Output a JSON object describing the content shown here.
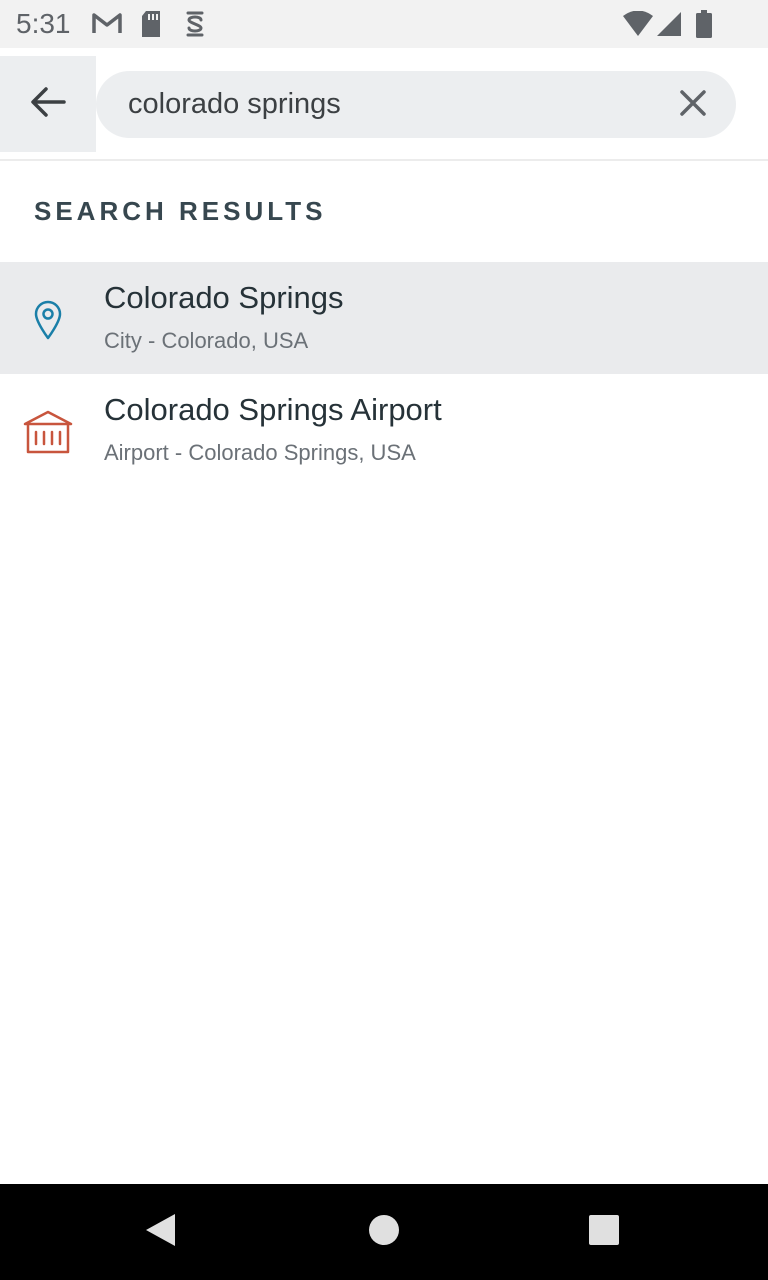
{
  "status_bar": {
    "time": "5:31",
    "left_icons": [
      "gmail-icon",
      "sd-card-icon",
      "sync-icon"
    ],
    "right_icons": [
      "wifi-icon",
      "cell-signal-icon",
      "battery-icon"
    ]
  },
  "search": {
    "query": "colorado springs",
    "back_icon": "arrow-left-icon",
    "clear_icon": "close-icon"
  },
  "section": {
    "title": "SEARCH RESULTS"
  },
  "results": [
    {
      "title": "Colorado Springs",
      "subtitle": "City - Colorado, USA",
      "icon": "location-pin-icon",
      "icon_color": "#1a7fa8",
      "highlighted": true
    },
    {
      "title": "Colorado Springs Airport",
      "subtitle": "Airport - Colorado Springs, USA",
      "icon": "airport-building-icon",
      "icon_color": "#c8553d",
      "highlighted": false
    }
  ],
  "nav_bar": {
    "buttons": [
      "back-nav-icon",
      "home-nav-icon",
      "recents-nav-icon"
    ]
  },
  "colors": {
    "accent_blue": "#1a7fa8",
    "accent_red": "#c8553d",
    "highlight_bg": "#eaebed",
    "text_primary": "#263238",
    "text_secondary": "#6b7177"
  }
}
